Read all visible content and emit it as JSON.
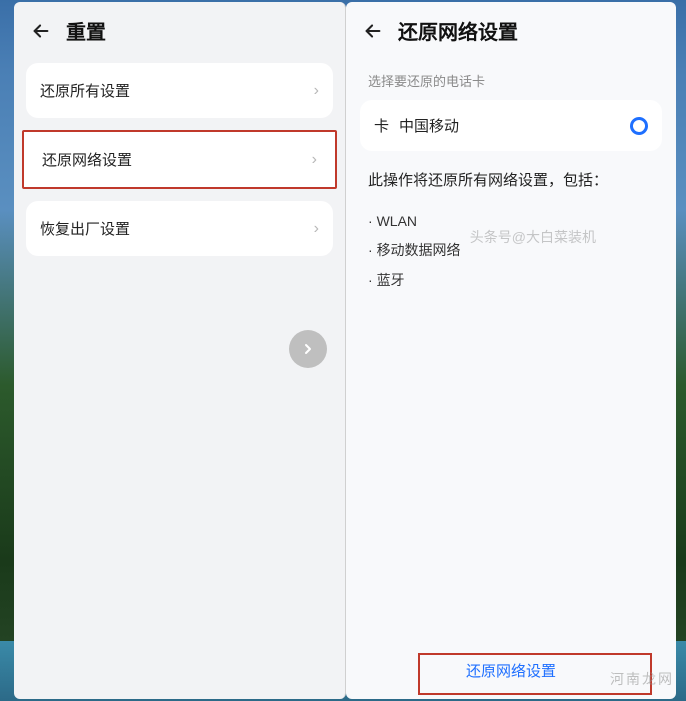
{
  "left": {
    "title": "重置",
    "items": [
      {
        "label": "还原所有设置"
      },
      {
        "label": "还原网络设置"
      },
      {
        "label": "恢复出厂设置"
      }
    ]
  },
  "right": {
    "title": "还原网络设置",
    "choose_sim_label": "选择要还原的电话卡",
    "sim_prefix": "卡",
    "sim_name": "中国移动",
    "description": "此操作将还原所有网络设置，包括：",
    "bullets": [
      "WLAN",
      "移动数据网络",
      "蓝牙"
    ],
    "confirm_label": "还原网络设置"
  },
  "watermark_site": "河南龙网",
  "watermark_bar": "头条号@大白菜装机"
}
